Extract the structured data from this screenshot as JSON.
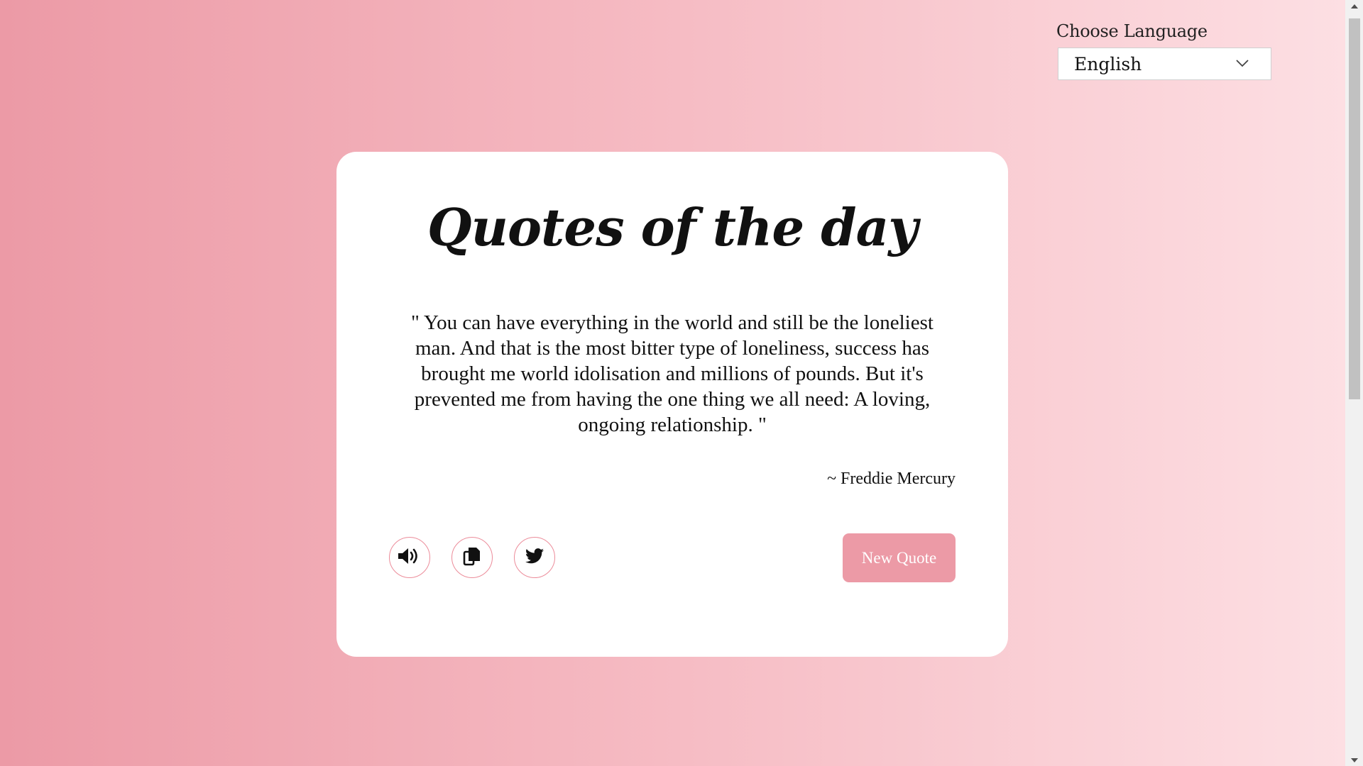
{
  "language": {
    "label": "Choose Language",
    "selected": "English"
  },
  "card": {
    "title": "Quotes of the day",
    "quote": "\" You can have everything in the world and still be the loneliest man. And that is the most bitter type of loneliness, success has brought me world idolisation and millions of pounds. But it's prevented me from having the one thing we all need: A loving, ongoing relationship. \"",
    "author": "~ Freddie Mercury",
    "new_quote_label": "New Quote",
    "icons": [
      "speaker-icon",
      "copy-icon",
      "twitter-icon"
    ]
  },
  "colors": {
    "accent": "#ec9aa6",
    "accent_border": "#ec8c9a",
    "gradient_start": "#ec9aa6",
    "gradient_end": "#fde0e4"
  }
}
